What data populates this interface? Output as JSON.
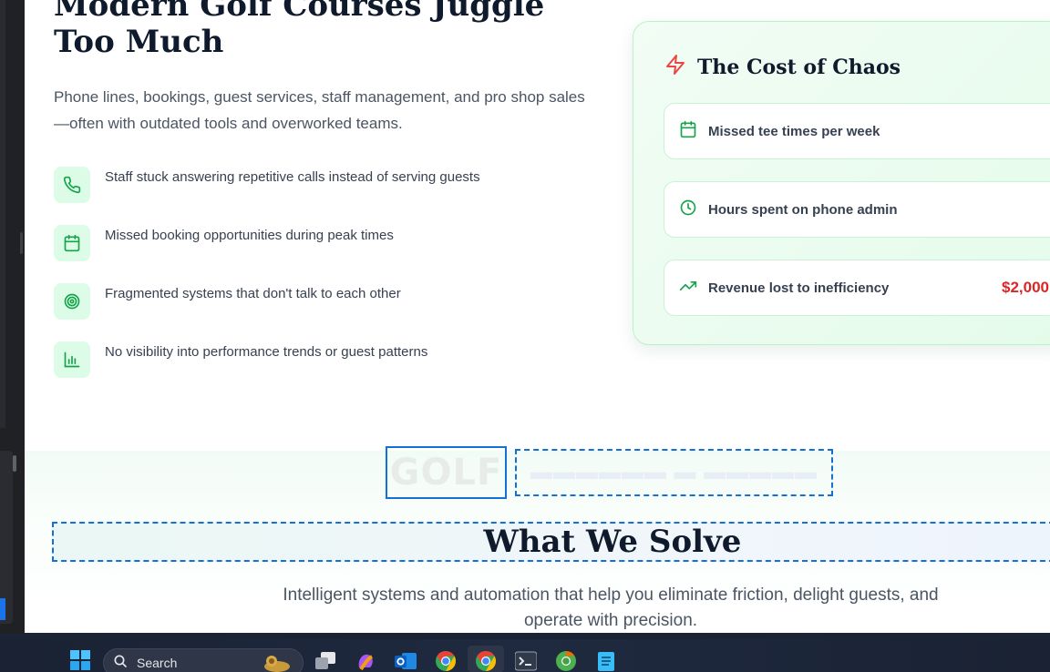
{
  "hero": {
    "title": "Modern Golf Courses Juggle Too Much",
    "subtitle": "Phone lines, bookings, guest services, staff management, and pro shop sales—often with outdated tools and overworked teams.",
    "pain_points": [
      {
        "icon": "phone-icon",
        "text": "Staff stuck answering repetitive calls instead of serving guests"
      },
      {
        "icon": "calendar-icon",
        "text": "Missed booking opportunities during peak times"
      },
      {
        "icon": "target-icon",
        "text": "Fragmented systems that don't talk to each other"
      },
      {
        "icon": "bar-chart-icon",
        "text": "No visibility into performance trends or guest patterns"
      }
    ]
  },
  "chaos_card": {
    "title": "The Cost of Chaos",
    "icon": "lightning-icon",
    "stats": [
      {
        "icon": "calendar-icon",
        "label": "Missed tee times per week",
        "value": ""
      },
      {
        "icon": "clock-icon",
        "label": "Hours spent on phone admin",
        "value": ""
      },
      {
        "icon": "trending-up-icon",
        "label": "Revenue lost to inefficiency",
        "value": "$2,000"
      }
    ]
  },
  "solve": {
    "logo_text": "GOLF",
    "title": "What We Solve",
    "subtitle": "Intelligent systems and automation that help you eliminate friction, delight guests, and operate with precision."
  },
  "taskbar": {
    "search_placeholder": "Search"
  },
  "colors": {
    "accent_green": "#16a34a",
    "icon_bg": "#dcfce7",
    "alert_red": "#dc2626",
    "heading": "#0f1b2d",
    "selection_blue": "#1570d6"
  }
}
